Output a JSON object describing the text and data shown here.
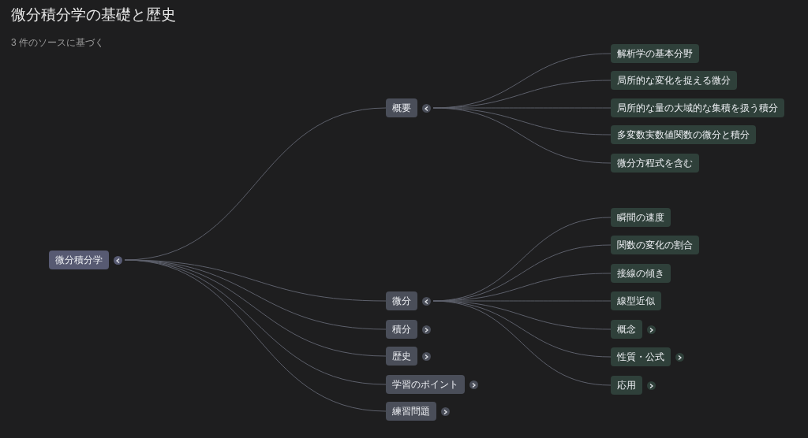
{
  "title": "微分積分学の基礎と歴史",
  "subtitle": "3 件のソースに基づく",
  "mindmap": {
    "label": "微分積分学",
    "expanded": true,
    "children": [
      {
        "label": "概要",
        "expanded": true,
        "children": [
          {
            "label": "解析学の基本分野"
          },
          {
            "label": "局所的な変化を捉える微分"
          },
          {
            "label": "局所的な量の大域的な集積を扱う積分"
          },
          {
            "label": "多変数実数値関数の微分と積分"
          },
          {
            "label": "微分方程式を含む"
          }
        ]
      },
      {
        "label": "微分",
        "expanded": true,
        "children": [
          {
            "label": "瞬間の速度"
          },
          {
            "label": "関数の変化の割合"
          },
          {
            "label": "接線の傾き"
          },
          {
            "label": "線型近似"
          },
          {
            "label": "概念",
            "expanded": false
          },
          {
            "label": "性質・公式",
            "expanded": false
          },
          {
            "label": "応用",
            "expanded": false
          }
        ]
      },
      {
        "label": "積分",
        "expanded": false
      },
      {
        "label": "歴史",
        "expanded": false
      },
      {
        "label": "学習のポイント",
        "expanded": false
      },
      {
        "label": "練習問題",
        "expanded": false
      }
    ]
  }
}
